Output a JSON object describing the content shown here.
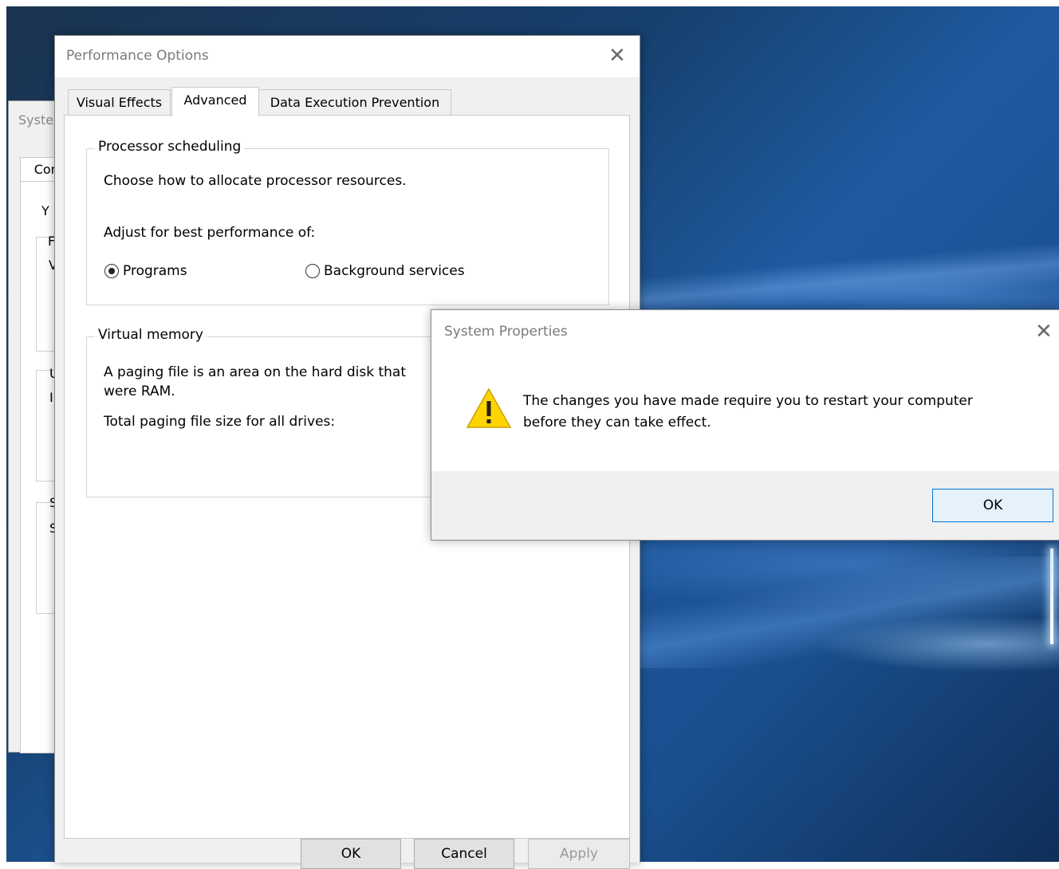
{
  "background_window": {
    "title_fragment": "Syste",
    "tab_fragment": "Com",
    "text_fragments": [
      "Y",
      "F",
      "V",
      "U",
      "I",
      "S",
      "S"
    ]
  },
  "performance_options": {
    "title": "Performance Options",
    "tabs": [
      {
        "label": "Visual Effects"
      },
      {
        "label": "Advanced"
      },
      {
        "label": "Data Execution Prevention"
      }
    ],
    "processor_scheduling": {
      "legend": "Processor scheduling",
      "description": "Choose how to allocate processor resources.",
      "adjust_label": "Adjust for best performance of:",
      "options": [
        {
          "label": "Programs",
          "selected": true
        },
        {
          "label": "Background services",
          "selected": false
        }
      ]
    },
    "virtual_memory": {
      "legend": "Virtual memory",
      "description_line1": "A paging file is an area on the hard disk that",
      "description_line2": "were RAM.",
      "total_label": "Total paging file size for all drives:"
    },
    "buttons": {
      "ok": "OK",
      "cancel": "Cancel",
      "apply": "Apply"
    }
  },
  "system_properties_dialog": {
    "title": "System Properties",
    "message_line1": "The changes you have made require you to restart your computer",
    "message_line2": "before they can take effect.",
    "ok": "OK",
    "icon": "warning-icon",
    "icon_color": "#ffd400"
  },
  "colors": {
    "accent": "#0078d7",
    "desktop": "#1f5aa0"
  }
}
